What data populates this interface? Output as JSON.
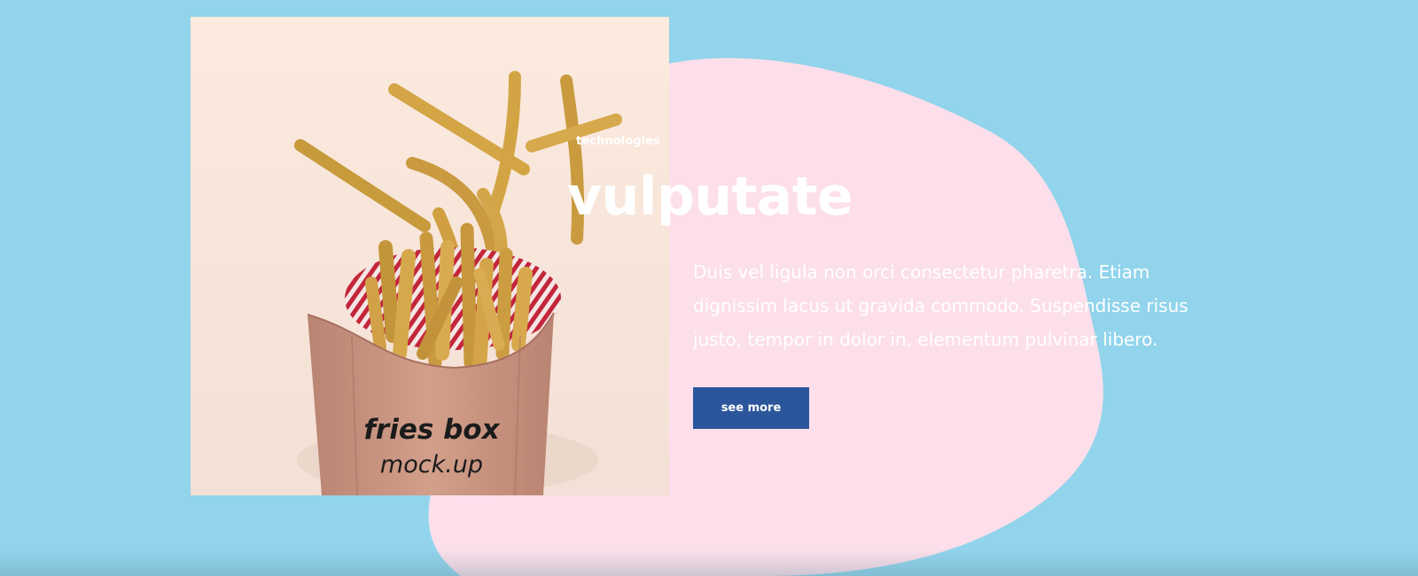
{
  "hero": {
    "eyebrow": "technologies",
    "title": "vulputate",
    "description": "Duis vel ligula non orci consectetur pharetra. Etiam dignissim lacus ut gravida commodo. Suspendisse risus justo, tempor in dolor in, elementum pulvinar libero.",
    "cta_label": "see more"
  },
  "product_image": {
    "box_text_line1": "fries box",
    "box_text_line2": "mock.up"
  },
  "colors": {
    "background": "#91d4ec",
    "blob": "#fcdfea",
    "button": "#2b569b",
    "text": "#ffffff"
  }
}
